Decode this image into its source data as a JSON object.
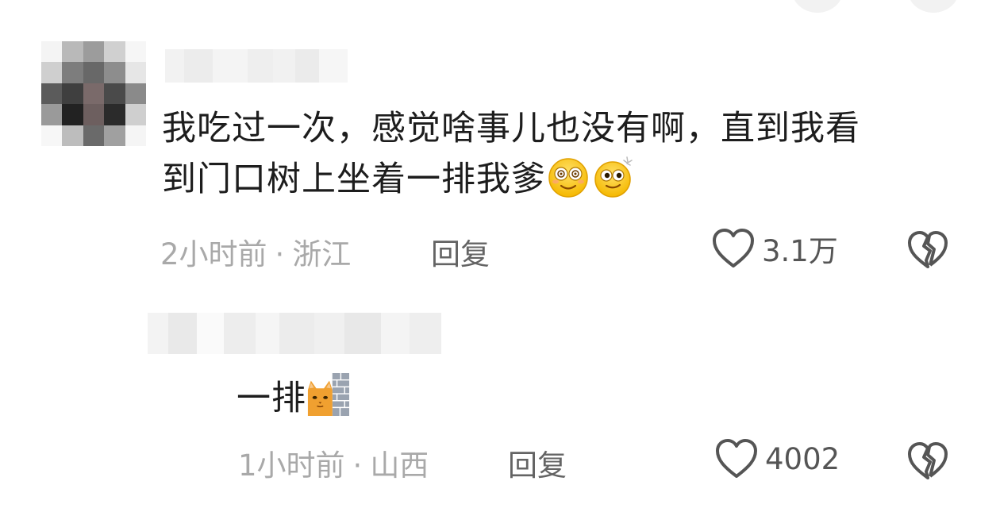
{
  "comments": [
    {
      "text_line1": "我吃过一次，感觉啥事儿也没有啊，直到我看",
      "text_line2": "到门口树上坐着一排我爹",
      "time": "2小时前",
      "location": "浙江",
      "reply_label": "回复",
      "like_count": "3.1万"
    },
    {
      "text": "一排",
      "time": "1小时前",
      "location": "山西",
      "reply_label": "回复",
      "like_count": "4002"
    }
  ],
  "separator": "·",
  "icons": {
    "like": "heart-outline-icon",
    "dislike": "broken-heart-icon",
    "emoji_1": "dizzy-eyes-emoji",
    "emoji_2": "sparkle-eyes-emoji",
    "emoji_3": "cat-peeking-wall-emoji"
  },
  "colors": {
    "text": "#1d1d1d",
    "meta": "#a9a9a9",
    "reply": "#646464",
    "icon": "#555555"
  }
}
